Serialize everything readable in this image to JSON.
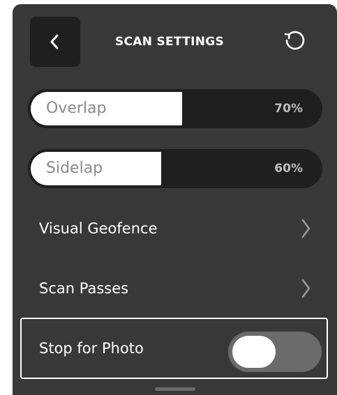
{
  "header": {
    "back_icon": "chevron-left-icon",
    "title": "SCAN SETTINGS",
    "reset_icon": "reset-icon"
  },
  "sliders": [
    {
      "label": "Overlap",
      "value_text": "70%",
      "value": 0.7
    },
    {
      "label": "Sidelap",
      "value_text": "60%",
      "value": 0.6
    }
  ],
  "menu": {
    "geofence_label": "Visual Geofence",
    "passes_label": "Scan Passes"
  },
  "stop_for_photo": {
    "label": "Stop for Photo",
    "enabled": false
  },
  "colors": {
    "panel": "#383838",
    "button_bg": "#1f1f1f",
    "slider_fill": "#ffffff",
    "toggle_track": "#6b6b6b"
  }
}
